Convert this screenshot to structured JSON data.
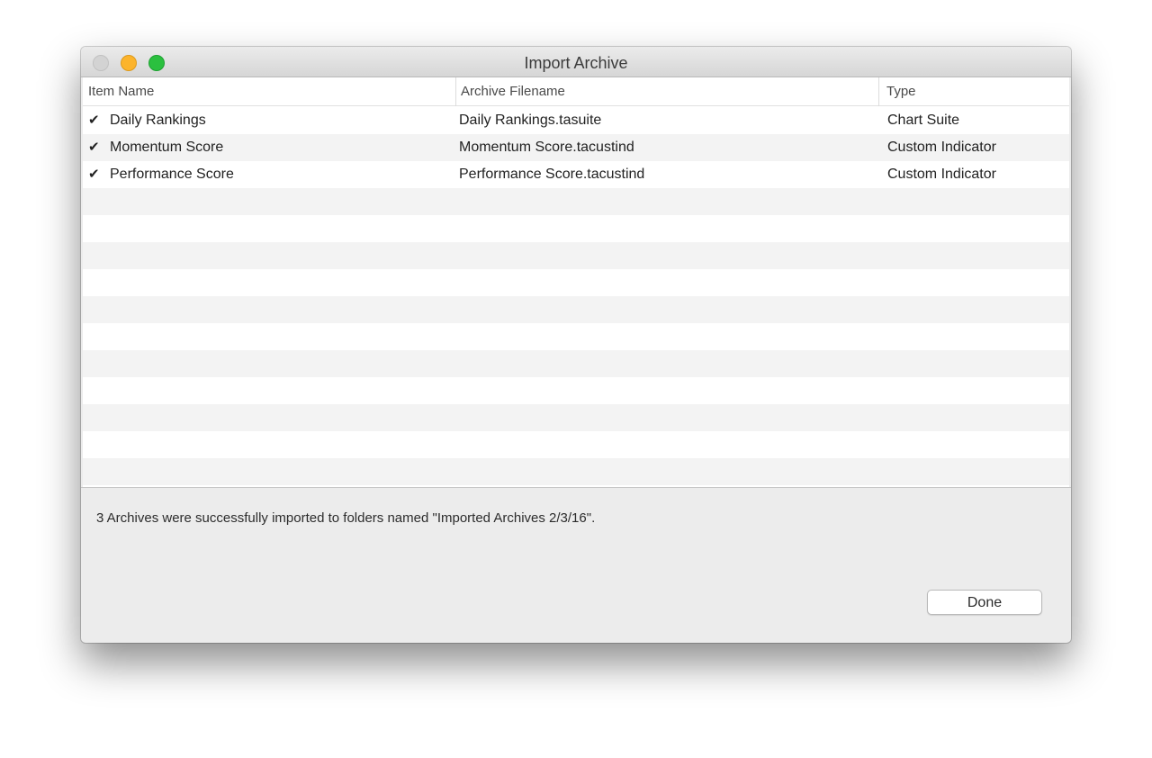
{
  "window": {
    "title": "Import Archive"
  },
  "table": {
    "columns": [
      "Item Name",
      "Archive Filename",
      "Type"
    ],
    "rows": [
      {
        "checked": true,
        "check_glyph": "✔",
        "name": "Daily Rankings",
        "file": "Daily Rankings.tasuite",
        "type": "Chart Suite"
      },
      {
        "checked": true,
        "check_glyph": "✔",
        "name": "Momentum Score",
        "file": "Momentum Score.tacustind",
        "type": "Custom Indicator"
      },
      {
        "checked": true,
        "check_glyph": "✔",
        "name": "Performance Score",
        "file": "Performance Score.tacustind",
        "type": "Custom Indicator"
      }
    ]
  },
  "status": {
    "message": "3 Archives were successfully imported to folders named \"Imported Archives 2/3/16\"."
  },
  "buttons": {
    "done_label": "Done"
  },
  "colors": {
    "close": "#d3d3d3",
    "minimize": "#fcb42c",
    "zoom": "#2bc03f",
    "row_stripe": "#f3f3f3"
  }
}
